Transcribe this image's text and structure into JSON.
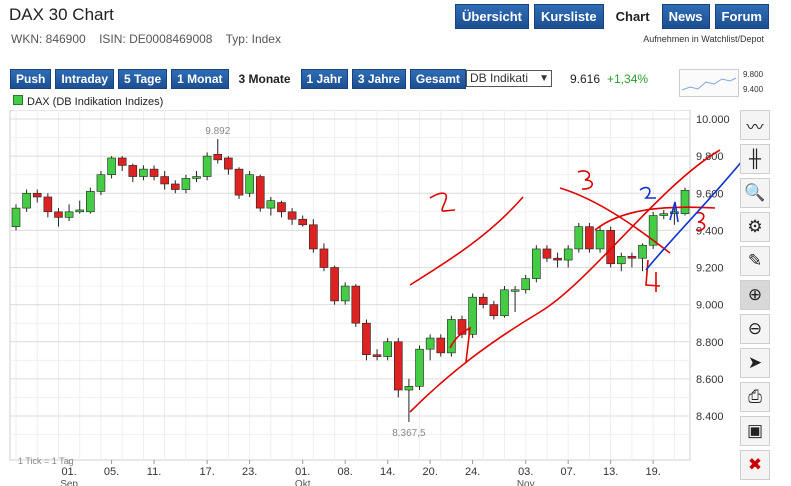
{
  "header": {
    "title": "DAX 30 Chart",
    "wkn": "WKN: 846900",
    "isin": "ISIN: DE0008469008",
    "type": "Typ: Index"
  },
  "nav": [
    {
      "label": "Übersicht"
    },
    {
      "label": "Kursliste"
    },
    {
      "label": "Chart"
    },
    {
      "label": "News"
    },
    {
      "label": "Forum"
    }
  ],
  "nav_active": "Chart",
  "watchlist": {
    "prefix": "Aufnehmen in",
    "link": "Watchlist/Depot"
  },
  "ranges": [
    {
      "label": "Push"
    },
    {
      "label": "Intraday"
    },
    {
      "label": "5 Tage"
    },
    {
      "label": "1 Monat"
    },
    {
      "label": "3 Monate"
    },
    {
      "label": "1 Jahr"
    },
    {
      "label": "3 Jahre"
    },
    {
      "label": "Gesamt"
    }
  ],
  "range_active": "3 Monate",
  "exchange_select": "DB Indikati",
  "quote": {
    "price": "9.616",
    "change": "+1,34%"
  },
  "mini_chart": {
    "high": "9.800",
    "low": "9.400"
  },
  "legend": "DAX (DB Indikation Indizes)",
  "tick_note": "1 Tick = 1 Tag",
  "colors": {
    "up": "#44cc44",
    "down": "#dd2222",
    "annotation_red": "#e00000",
    "annotation_blue": "#1133cc",
    "button": "#1d4f91"
  },
  "tools": [
    {
      "icon": "line-chart-icon"
    },
    {
      "icon": "ohlc-icon"
    },
    {
      "icon": "indicator-icon"
    },
    {
      "icon": "settings-icon"
    },
    {
      "icon": "draw-pencil-icon"
    },
    {
      "icon": "zoom-in-icon"
    },
    {
      "icon": "zoom-out-icon"
    },
    {
      "icon": "pointer-icon"
    },
    {
      "icon": "print-icon"
    },
    {
      "icon": "save-icon"
    },
    {
      "icon": "delete-icon"
    }
  ],
  "chart_data": {
    "type": "candlestick",
    "ylim": [
      8250,
      10050
    ],
    "y_ticks": [
      "10.000",
      "9.800",
      "9.600",
      "9.400",
      "9.200",
      "9.000",
      "8.800",
      "8.600",
      "8.400"
    ],
    "y_tick_values": [
      10000,
      9800,
      9600,
      9400,
      9200,
      9000,
      8800,
      8600,
      8400
    ],
    "x_tick_labels": [
      "01.",
      "05.",
      "11.",
      "17.",
      "23.",
      "01.",
      "08.",
      "14.",
      "20.",
      "24.",
      "03.",
      "07.",
      "13.",
      "19."
    ],
    "x_tick_candle_index": [
      5,
      9,
      13,
      18,
      22,
      27,
      31,
      35,
      39,
      43,
      48,
      52,
      56,
      60
    ],
    "month_labels": [
      "Sep",
      "Okt",
      "Nov"
    ],
    "month_candle_index": [
      5,
      27,
      48
    ],
    "annotations": [
      "9.892",
      "8.367,5"
    ],
    "candles": [
      {
        "o": 9420,
        "c": 9520,
        "h": 9540,
        "l": 9400
      },
      {
        "o": 9520,
        "c": 9600,
        "h": 9620,
        "l": 9500
      },
      {
        "o": 9600,
        "c": 9580,
        "h": 9620,
        "l": 9550
      },
      {
        "o": 9580,
        "c": 9500,
        "h": 9600,
        "l": 9470
      },
      {
        "o": 9500,
        "c": 9470,
        "h": 9520,
        "l": 9420
      },
      {
        "o": 9470,
        "c": 9500,
        "h": 9540,
        "l": 9450
      },
      {
        "o": 9500,
        "c": 9510,
        "h": 9560,
        "l": 9490
      },
      {
        "o": 9500,
        "c": 9610,
        "h": 9630,
        "l": 9490
      },
      {
        "o": 9610,
        "c": 9700,
        "h": 9720,
        "l": 9590
      },
      {
        "o": 9700,
        "c": 9790,
        "h": 9800,
        "l": 9680
      },
      {
        "o": 9790,
        "c": 9750,
        "h": 9800,
        "l": 9720
      },
      {
        "o": 9750,
        "c": 9690,
        "h": 9760,
        "l": 9660
      },
      {
        "o": 9690,
        "c": 9730,
        "h": 9750,
        "l": 9670
      },
      {
        "o": 9730,
        "c": 9690,
        "h": 9750,
        "l": 9670
      },
      {
        "o": 9690,
        "c": 9650,
        "h": 9720,
        "l": 9620
      },
      {
        "o": 9650,
        "c": 9620,
        "h": 9670,
        "l": 9600
      },
      {
        "o": 9620,
        "c": 9680,
        "h": 9700,
        "l": 9600
      },
      {
        "o": 9680,
        "c": 9690,
        "h": 9720,
        "l": 9660
      },
      {
        "o": 9690,
        "c": 9800,
        "h": 9820,
        "l": 9670
      },
      {
        "o": 9810,
        "c": 9780,
        "h": 9892,
        "l": 9760
      },
      {
        "o": 9790,
        "c": 9730,
        "h": 9800,
        "l": 9700
      },
      {
        "o": 9730,
        "c": 9590,
        "h": 9740,
        "l": 9570
      },
      {
        "o": 9600,
        "c": 9700,
        "h": 9720,
        "l": 9580
      },
      {
        "o": 9690,
        "c": 9520,
        "h": 9700,
        "l": 9500
      },
      {
        "o": 9520,
        "c": 9560,
        "h": 9580,
        "l": 9480
      },
      {
        "o": 9550,
        "c": 9500,
        "h": 9560,
        "l": 9470
      },
      {
        "o": 9500,
        "c": 9460,
        "h": 9520,
        "l": 9430
      },
      {
        "o": 9460,
        "c": 9430,
        "h": 9480,
        "l": 9420
      },
      {
        "o": 9430,
        "c": 9300,
        "h": 9460,
        "l": 9280
      },
      {
        "o": 9300,
        "c": 9200,
        "h": 9330,
        "l": 9180
      },
      {
        "o": 9200,
        "c": 9020,
        "h": 9210,
        "l": 9000
      },
      {
        "o": 9020,
        "c": 9100,
        "h": 9120,
        "l": 9000
      },
      {
        "o": 9100,
        "c": 8900,
        "h": 9110,
        "l": 8880
      },
      {
        "o": 8900,
        "c": 8730,
        "h": 8920,
        "l": 8700
      },
      {
        "o": 8730,
        "c": 8720,
        "h": 8760,
        "l": 8700
      },
      {
        "o": 8720,
        "c": 8800,
        "h": 8820,
        "l": 8700
      },
      {
        "o": 8800,
        "c": 8540,
        "h": 8820,
        "l": 8500
      },
      {
        "o": 8540,
        "c": 8560,
        "h": 8600,
        "l": 8367.5
      },
      {
        "o": 8560,
        "c": 8760,
        "h": 8780,
        "l": 8540
      },
      {
        "o": 8760,
        "c": 8820,
        "h": 8840,
        "l": 8700
      },
      {
        "o": 8820,
        "c": 8740,
        "h": 8840,
        "l": 8720
      },
      {
        "o": 8740,
        "c": 8920,
        "h": 8940,
        "l": 8720
      },
      {
        "o": 8920,
        "c": 8840,
        "h": 8940,
        "l": 8820
      },
      {
        "o": 8840,
        "c": 9040,
        "h": 9060,
        "l": 8820
      },
      {
        "o": 9040,
        "c": 9000,
        "h": 9060,
        "l": 8980
      },
      {
        "o": 9000,
        "c": 8940,
        "h": 9020,
        "l": 8920
      },
      {
        "o": 8940,
        "c": 9080,
        "h": 9100,
        "l": 8930
      },
      {
        "o": 9080,
        "c": 9080,
        "h": 9100,
        "l": 8960
      },
      {
        "o": 9080,
        "c": 9140,
        "h": 9160,
        "l": 9060
      },
      {
        "o": 9140,
        "c": 9300,
        "h": 9320,
        "l": 9120
      },
      {
        "o": 9300,
        "c": 9250,
        "h": 9320,
        "l": 9230
      },
      {
        "o": 9250,
        "c": 9240,
        "h": 9280,
        "l": 9200
      },
      {
        "o": 9240,
        "c": 9300,
        "h": 9320,
        "l": 9200
      },
      {
        "o": 9300,
        "c": 9420,
        "h": 9440,
        "l": 9280
      },
      {
        "o": 9420,
        "c": 9300,
        "h": 9440,
        "l": 9280
      },
      {
        "o": 9300,
        "c": 9400,
        "h": 9420,
        "l": 9280
      },
      {
        "o": 9400,
        "c": 9220,
        "h": 9420,
        "l": 9200
      },
      {
        "o": 9220,
        "c": 9260,
        "h": 9280,
        "l": 9180
      },
      {
        "o": 9260,
        "c": 9250,
        "h": 9280,
        "l": 9200
      },
      {
        "o": 9250,
        "c": 9320,
        "h": 9330,
        "l": 9180
      },
      {
        "o": 9320,
        "c": 9480,
        "h": 9500,
        "l": 9300
      },
      {
        "o": 9480,
        "c": 9490,
        "h": 9510,
        "l": 9460
      },
      {
        "o": 9490,
        "c": 9500,
        "h": 9520,
        "l": 9430
      },
      {
        "o": 9490,
        "c": 9616,
        "h": 9630,
        "l": 9480
      }
    ]
  }
}
